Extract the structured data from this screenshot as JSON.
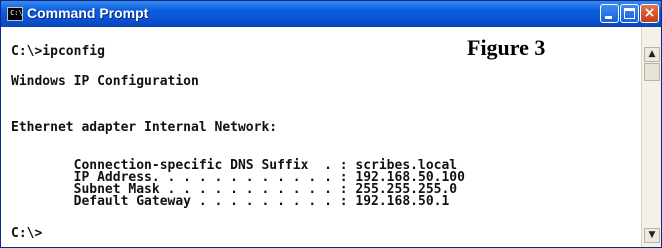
{
  "window": {
    "title": "Command Prompt",
    "icon_label": "C:\\",
    "minimize_label": "",
    "maximize_label": "",
    "close_label": "×"
  },
  "figure_label": "Figure 3",
  "console": {
    "lines": [
      "C:\\>ipconfig",
      "Windows IP Configuration",
      "Ethernet adapter Internal Network:",
      "        Connection-specific DNS Suffix  . : scribes.local",
      "        IP Address. . . . . . . . . . . . : 192.168.50.100",
      "        Subnet Mask . . . . . . . . . . . : 255.255.255.0",
      "        Default Gateway . . . . . . . . . : 192.168.50.1",
      "C:\\>"
    ]
  },
  "scrollbar": {
    "up_glyph": "▲",
    "down_glyph": "▼"
  }
}
